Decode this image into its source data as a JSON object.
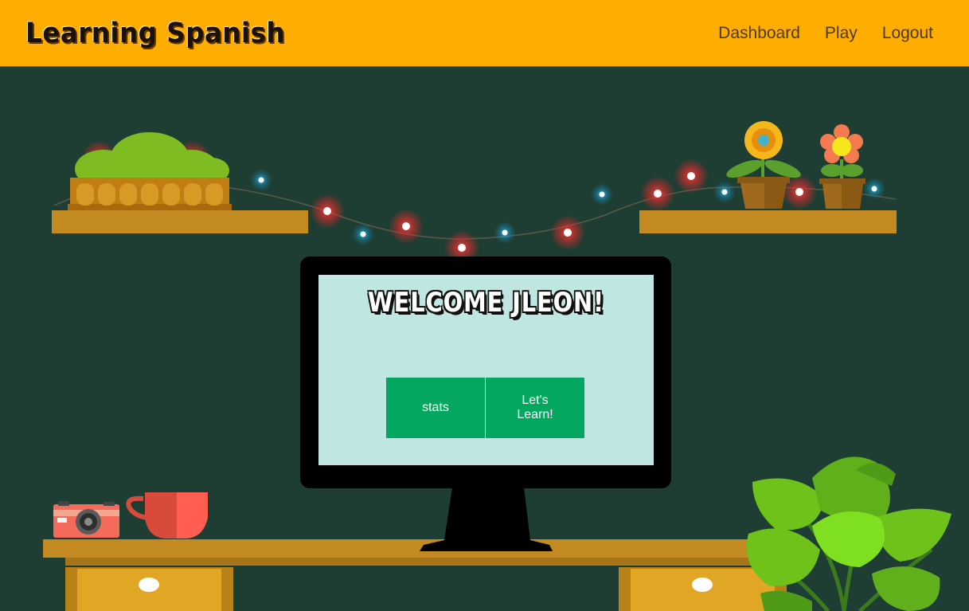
{
  "app": {
    "brand": "Learning Spanish",
    "nav": [
      {
        "label": "Dashboard"
      },
      {
        "label": "Play"
      },
      {
        "label": "Logout"
      }
    ]
  },
  "main": {
    "welcome": "Welcome jleon!",
    "buttons": {
      "stats": "stats",
      "learn": "Let's Learn!"
    }
  },
  "colors": {
    "navbar": "#ffad00",
    "background": "#1e3d33",
    "screen": "#bfe6e0",
    "button": "#04a75f",
    "shelf": "#c48a22"
  }
}
